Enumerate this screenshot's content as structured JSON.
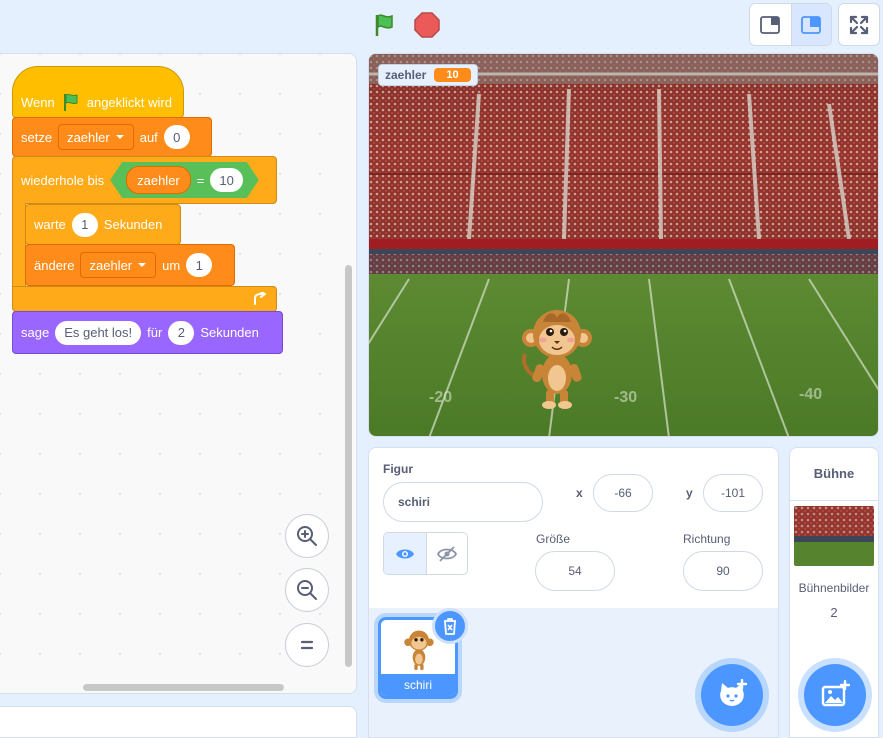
{
  "blocks": {
    "hat": {
      "part1": "Wenn",
      "part2": "angeklickt wird"
    },
    "set_var": {
      "label": "setze",
      "var": "zaehler",
      "to": "auf",
      "value": "0"
    },
    "repeat_until": {
      "label": "wiederhole bis",
      "var": "zaehler",
      "op": "=",
      "value": "10"
    },
    "wait": {
      "label": "warte",
      "value": "1",
      "unit": "Sekunden"
    },
    "change_var": {
      "label": "ändere",
      "var": "zaehler",
      "by": "um",
      "value": "1"
    },
    "say": {
      "label": "sage",
      "text": "Es geht los!",
      "for": "für",
      "value": "2",
      "unit": "Sekunden"
    }
  },
  "stage": {
    "monitor_name": "zaehler",
    "monitor_value": "10"
  },
  "sprite_info": {
    "figur_label": "Figur",
    "name": "schiri",
    "x_label": "x",
    "x": "-66",
    "y_label": "y",
    "y": "-101",
    "size_label": "Größe",
    "size": "54",
    "direction_label": "Richtung",
    "direction": "90"
  },
  "sprite_list": [
    {
      "name": "schiri"
    }
  ],
  "stage_pane": {
    "title": "Bühne",
    "backdrops_label": "Bühnenbilder",
    "backdrops_count": "2"
  },
  "colors": {
    "accent": "#4c97ff",
    "events": "#ffbf00",
    "variables": "#ff8c1a",
    "control": "#ffab19",
    "looks": "#9966ff",
    "operators": "#59c059"
  }
}
